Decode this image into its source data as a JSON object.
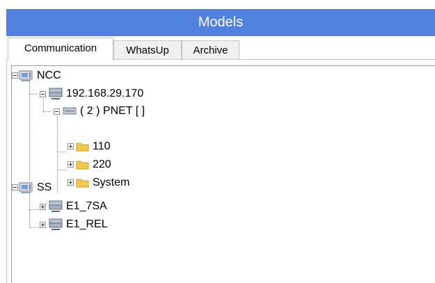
{
  "title": "Models",
  "tabs": [
    {
      "label": "Communication"
    },
    {
      "label": "WhatsUp"
    },
    {
      "label": "Archive"
    }
  ],
  "tree": {
    "ncc": "NCC",
    "ip": "192.168.29.170",
    "pnet": "( 2 ) PNET [ ]",
    "f110": "110",
    "f220": "220",
    "system": "System",
    "ss": "SS",
    "e1_7sa": "E1_7SA",
    "e1_rel": "E1_REL"
  },
  "colors": {
    "title_bg": "#5181df",
    "folder": "#f2c94c"
  }
}
